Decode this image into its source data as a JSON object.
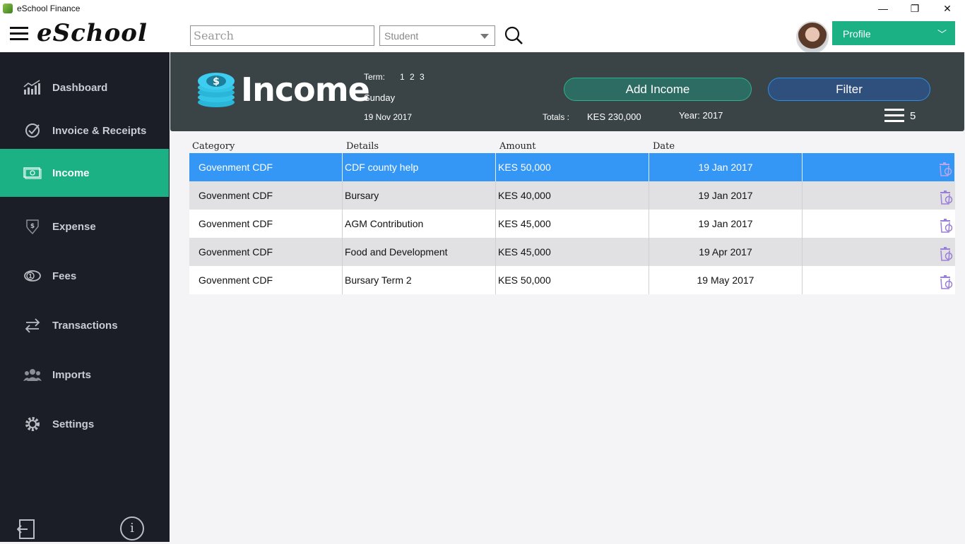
{
  "window": {
    "title": "eSchool Finance",
    "minimize": "—",
    "maximize": "❐",
    "close": "✕"
  },
  "header": {
    "logo": "eSchool",
    "search": {
      "placeholder": "Search",
      "value": ""
    },
    "type_select": {
      "selected": "Student"
    },
    "profile": {
      "label": "Profile",
      "chevron": "﹀"
    }
  },
  "sidebar": {
    "items": [
      {
        "label": "Dashboard",
        "icon": "chart-icon"
      },
      {
        "label": "Invoice & Receipts",
        "icon": "check-circle-icon"
      },
      {
        "label": "Income",
        "icon": "cash-icon",
        "active": true
      },
      {
        "label": "Expense",
        "icon": "shield-dollar-icon"
      },
      {
        "label": "Fees",
        "icon": "coin-icon"
      },
      {
        "label": "Transactions",
        "icon": "swap-arrows-icon"
      },
      {
        "label": "Imports",
        "icon": "group-icon"
      },
      {
        "label": "Settings",
        "icon": "gear-icon"
      }
    ],
    "info": "i"
  },
  "panel": {
    "title": "Income",
    "term_label": "Term:",
    "terms": "1 2 3",
    "day": "Sunday",
    "date": "19 Nov 2017",
    "totals_label": "Totals :",
    "totals_value": "KES 230,000",
    "year": "Year: 2017",
    "add_button": "Add Income",
    "filter_button": "Filter",
    "count": "5"
  },
  "table": {
    "columns": [
      "Category",
      "Details",
      "Amount",
      "Date"
    ],
    "rows": [
      {
        "category": "Govenment CDF",
        "details": "CDF county help",
        "amount": "KES 50,000",
        "date": "19 Jan 2017",
        "selected": true
      },
      {
        "category": "Govenment CDF",
        "details": "Bursary",
        "amount": "KES 40,000",
        "date": "19 Jan 2017"
      },
      {
        "category": "Govenment CDF",
        "details": "AGM Contribution",
        "amount": "KES 45,000",
        "date": "19 Jan 2017"
      },
      {
        "category": "Govenment CDF",
        "details": "Food and Development",
        "amount": "KES 45,000",
        "date": "19 Apr 2017"
      },
      {
        "category": "Govenment CDF",
        "details": "Bursary Term 2",
        "amount": "KES 50,000",
        "date": "19 May 2017"
      }
    ]
  },
  "colors": {
    "accent": "#1bb185",
    "sidebar": "#1b1d27",
    "panel": "#3a4447",
    "selected_row": "#3597f5",
    "delete_icon": "#9b7fd6"
  }
}
